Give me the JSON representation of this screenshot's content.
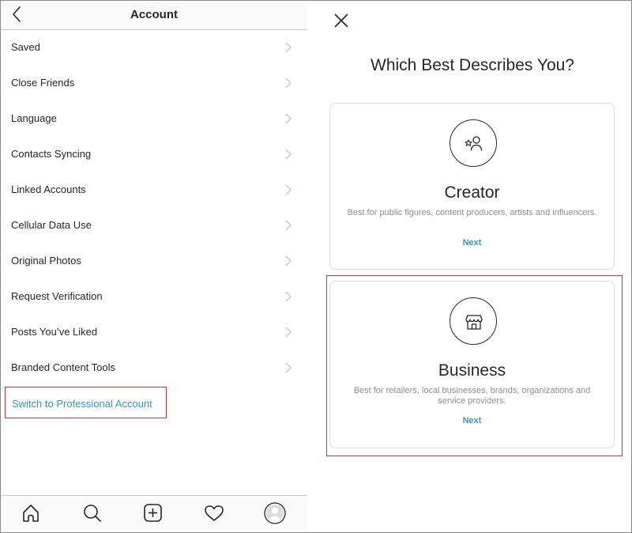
{
  "left_panel": {
    "header": {
      "title": "Account",
      "back_icon": "chevron-left-icon"
    },
    "menu_items": [
      {
        "label": "Saved"
      },
      {
        "label": "Close Friends"
      },
      {
        "label": "Language"
      },
      {
        "label": "Contacts Syncing"
      },
      {
        "label": "Linked Accounts"
      },
      {
        "label": "Cellular Data Use"
      },
      {
        "label": "Original Photos"
      },
      {
        "label": "Request Verification"
      },
      {
        "label": "Posts You’ve Liked"
      },
      {
        "label": "Branded Content Tools"
      }
    ],
    "professional_link": {
      "label": "Switch to Professional Account",
      "highlighted": true
    },
    "tab_bar": [
      {
        "name": "home",
        "icon": "home-icon"
      },
      {
        "name": "search",
        "icon": "search-icon"
      },
      {
        "name": "new-post",
        "icon": "plus-square-icon"
      },
      {
        "name": "activity",
        "icon": "heart-icon"
      },
      {
        "name": "profile",
        "icon": "avatar-icon"
      }
    ]
  },
  "right_panel": {
    "close_icon": "close-icon",
    "title": "Which Best Describes You?",
    "options": [
      {
        "id": "creator",
        "icon": "creator-star-person-icon",
        "title": "Creator",
        "description": "Best for public figures, content producers, artists and influencers.",
        "action": "Next",
        "highlighted": false
      },
      {
        "id": "business",
        "icon": "storefront-icon",
        "title": "Business",
        "description": "Best for retailers, local businesses, brands, organizations and service providers.",
        "action": "Next",
        "highlighted": true
      }
    ]
  },
  "colors": {
    "link_blue": "#3897c9",
    "highlight_red": "#c8353d",
    "text_dark": "#262626",
    "text_muted": "#8e8e8e",
    "chrome_bg": "#fafafa"
  }
}
